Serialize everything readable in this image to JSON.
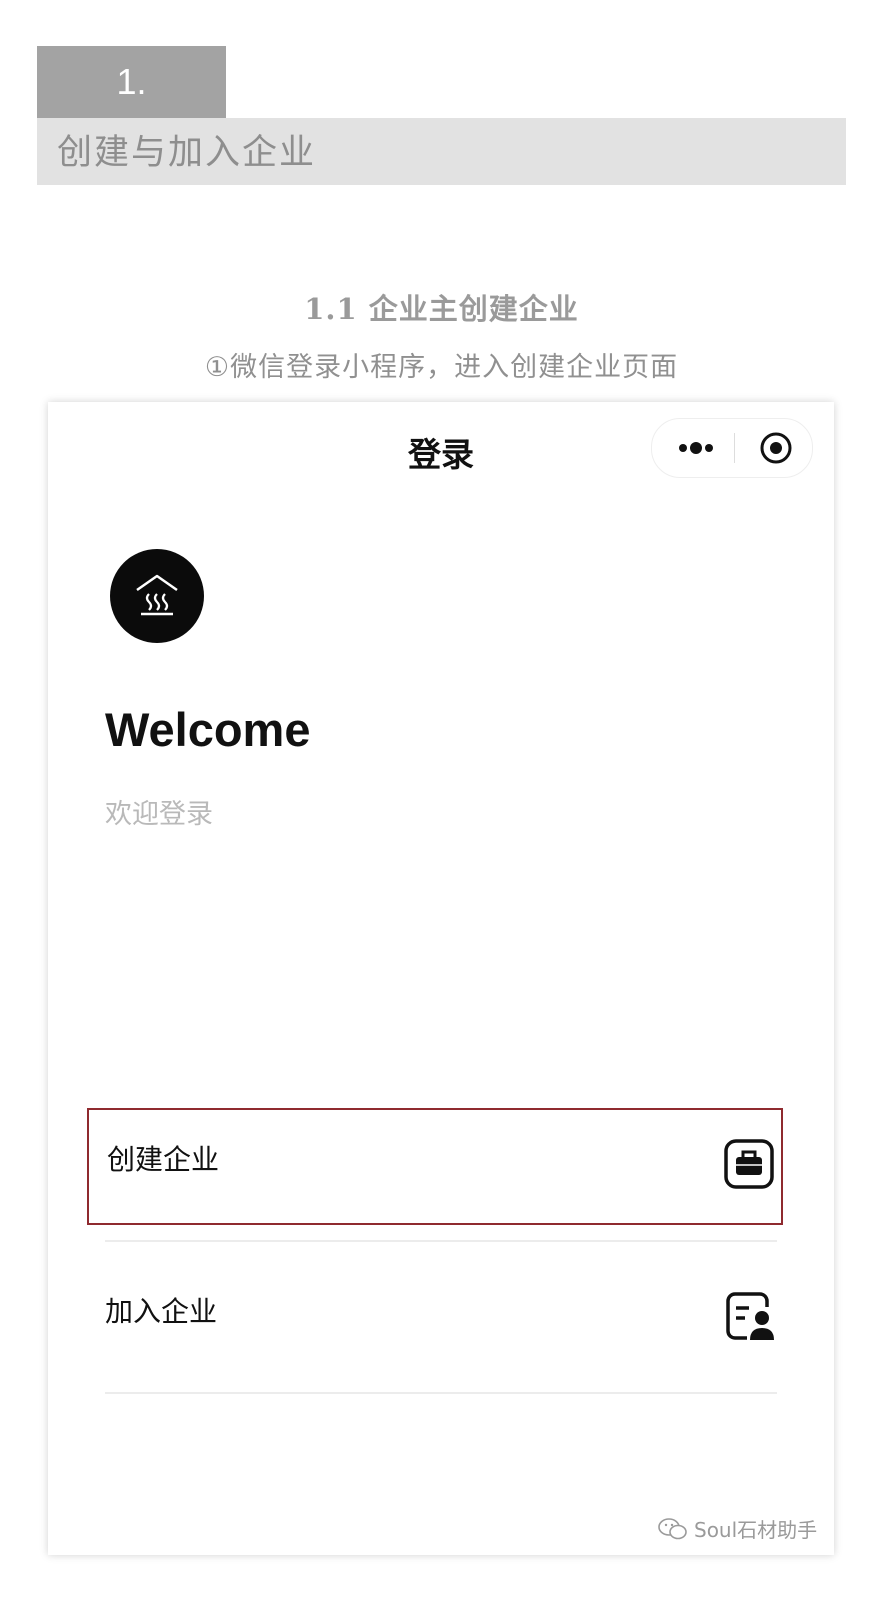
{
  "section": {
    "number": "1.",
    "title": "创建与加入企业"
  },
  "subheading": "1.1 企业主创建企业",
  "caption": "①微信登录小程序，进入创建企业页面",
  "screen": {
    "nav_title": "登录",
    "capsule": {
      "more_icon": "more-dots-icon",
      "close_icon": "target-circle-icon"
    },
    "logo_icon": "house-steam-icon",
    "welcome": "Welcome",
    "welcome_sub": "欢迎登录",
    "options": [
      {
        "label": "创建企业",
        "icon": "briefcase-icon",
        "highlighted": true
      },
      {
        "label": "加入企业",
        "icon": "id-card-person-icon",
        "highlighted": false
      }
    ],
    "watermark": "Soul石材助手"
  },
  "colors": {
    "number_block": "#a3a3a3",
    "title_bar": "#e2e2e2",
    "highlight_border": "#8f2a2f",
    "logo_bg": "#0b0b0b"
  }
}
